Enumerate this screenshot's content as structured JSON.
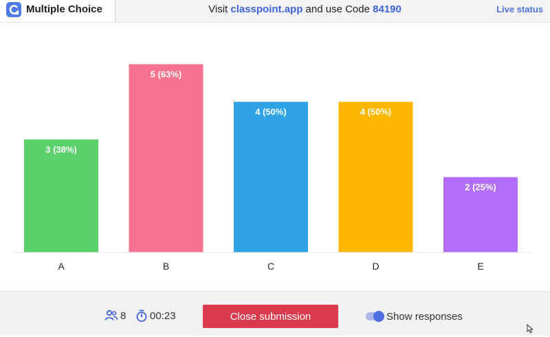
{
  "header": {
    "app_title": "Multiple Choice",
    "visit_prefix": "Visit ",
    "visit_site": "classpoint.app",
    "visit_middle": " and use Code ",
    "visit_code": "84190",
    "live_status": "Live status",
    "logo_icon": "classpoint-logo-icon"
  },
  "chart_data": {
    "type": "bar",
    "categories": [
      "A",
      "B",
      "C",
      "D",
      "E"
    ],
    "values": [
      3,
      5,
      4,
      4,
      2
    ],
    "labels": [
      "3 (38%)",
      "5 (63%)",
      "4 (50%)",
      "4 (50%)",
      "2 (25%)"
    ],
    "colors": [
      "#5ad16a",
      "#f6728e",
      "#2ea3e6",
      "#fdb701",
      "#b26ef9"
    ],
    "ylim": [
      0,
      5.5
    ],
    "grid": false,
    "title": "",
    "xlabel": "",
    "ylabel": ""
  },
  "footer": {
    "participants_icon": "people-icon",
    "participants_count": "8",
    "timer_icon": "stopwatch-icon",
    "timer": "00:23",
    "close_button": "Close submission",
    "toggle_label": "Show responses",
    "toggle_on": true,
    "accent": "#4f6fe0"
  }
}
